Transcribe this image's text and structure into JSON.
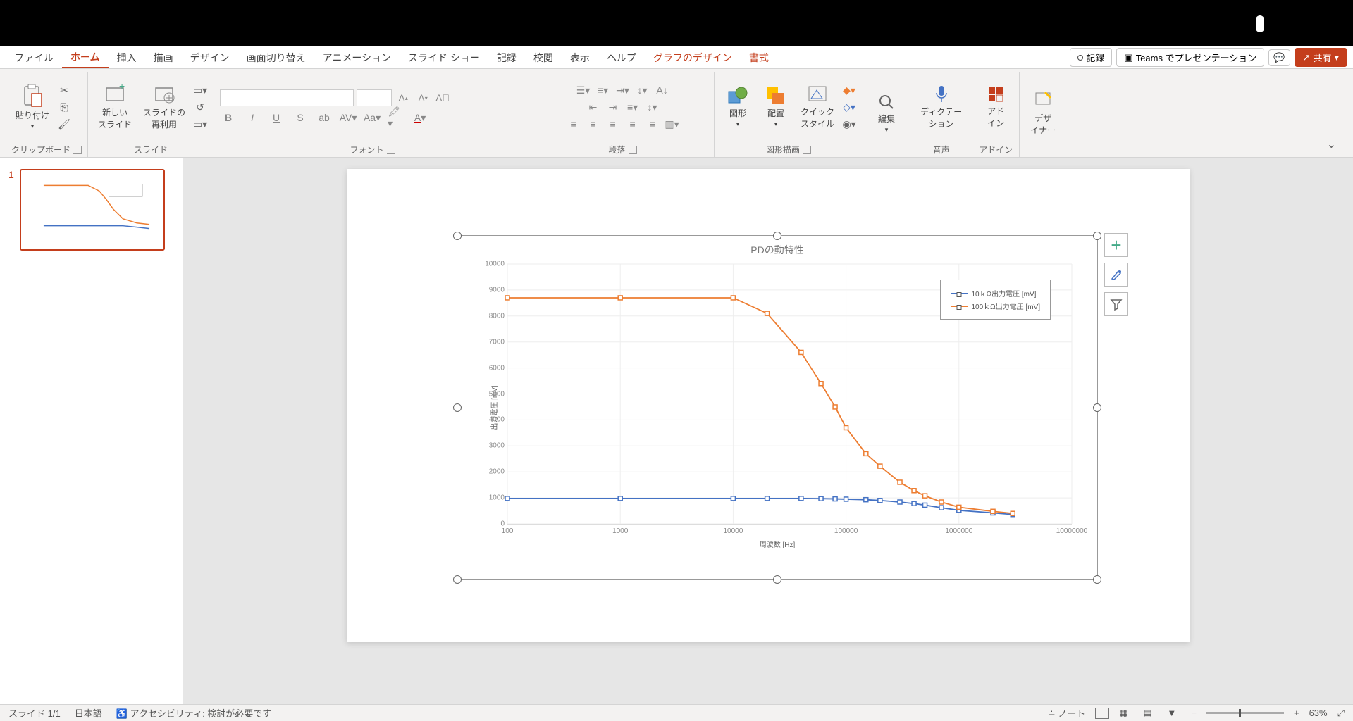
{
  "menu": {
    "file": "ファイル",
    "home": "ホーム",
    "insert": "挿入",
    "draw": "描画",
    "design": "デザイン",
    "transitions": "画面切り替え",
    "animations": "アニメーション",
    "slideshow": "スライド ショー",
    "record": "記録",
    "review": "校閲",
    "view": "表示",
    "help": "ヘルプ",
    "chart_design": "グラフのデザイン",
    "format": "書式",
    "record_btn": "記録",
    "teams_btn": "Teams でプレゼンテーション",
    "share_btn": "共有"
  },
  "ribbon": {
    "clipboard": {
      "paste": "貼り付け",
      "label": "クリップボード"
    },
    "slides": {
      "new_slide": "新しい\nスライド",
      "reuse": "スライドの\n再利用",
      "label": "スライド"
    },
    "font": {
      "label": "フォント"
    },
    "paragraph": {
      "label": "段落"
    },
    "drawing": {
      "shapes": "図形",
      "arrange": "配置",
      "quick_styles": "クイック\nスタイル",
      "label": "図形描画"
    },
    "editing": {
      "label": "編集"
    },
    "voice": {
      "dictate": "ディクテー\nション",
      "label": "音声"
    },
    "addins": {
      "addin": "アド\nイン",
      "label": "アドイン"
    },
    "designer": {
      "designer": "デザ\nイナー"
    }
  },
  "thumbnail": {
    "num": "1"
  },
  "chart_data": {
    "type": "line",
    "title": "PDの動特性",
    "xlabel": "周波数 [Hz]",
    "ylabel": "出力電圧 [mV]",
    "x_scale": "log",
    "xlim": [
      100,
      10000000
    ],
    "ylim": [
      0,
      10000
    ],
    "y_ticks": [
      0,
      1000,
      2000,
      3000,
      4000,
      5000,
      6000,
      7000,
      8000,
      9000,
      10000
    ],
    "x_ticks": [
      100,
      1000,
      10000,
      100000,
      1000000,
      10000000
    ],
    "series": [
      {
        "name": "10ｋΩ出力電圧 [mV]",
        "color": "#4472C4",
        "x": [
          100,
          1000,
          10000,
          20000,
          40000,
          60000,
          80000,
          100000,
          150000,
          200000,
          300000,
          400000,
          500000,
          700000,
          1000000,
          2000000,
          3000000
        ],
        "y": [
          980,
          980,
          980,
          980,
          980,
          970,
          960,
          950,
          930,
          900,
          840,
          780,
          720,
          620,
          520,
          420,
          360
        ]
      },
      {
        "name": "100ｋΩ出力電圧 [mV]",
        "color": "#ED7D31",
        "x": [
          100,
          1000,
          10000,
          20000,
          40000,
          60000,
          80000,
          100000,
          150000,
          200000,
          300000,
          400000,
          500000,
          700000,
          1000000,
          2000000,
          3000000
        ],
        "y": [
          8700,
          8700,
          8700,
          8100,
          6600,
          5400,
          4500,
          3700,
          2700,
          2220,
          1600,
          1280,
          1080,
          840,
          640,
          480,
          400
        ]
      }
    ]
  },
  "side_tools": {
    "plus": "+",
    "brush": "brush",
    "funnel": "filter"
  },
  "status": {
    "slide": "スライド 1/1",
    "lang": "日本語",
    "a11y": "アクセシビリティ: 検討が必要です",
    "notes": "ノート",
    "zoom": "63%"
  }
}
